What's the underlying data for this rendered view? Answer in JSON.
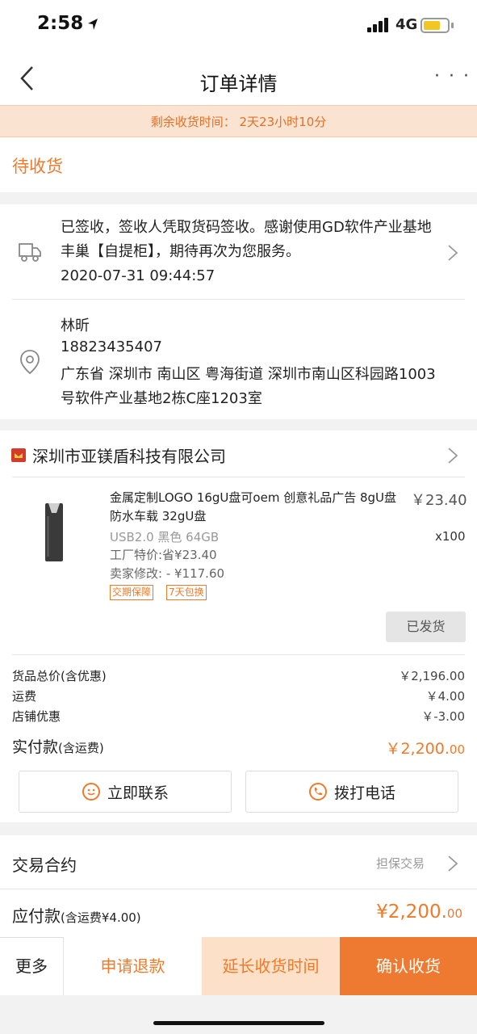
{
  "status_bar": {
    "time": "2:58",
    "network": "4G"
  },
  "nav": {
    "title": "订单详情",
    "more": "· · ·"
  },
  "countdown": "剩余收货时间：  2天23小时10分",
  "order_status": "待收货",
  "logistics": {
    "message": "已签收，签收人凭取货码签收。感谢使用GD软件产业基地丰巢【自提柜】，期待再次为您服务。",
    "time": "2020-07-31 09:44:57"
  },
  "address": {
    "name": "林昕",
    "phone": "18823435407",
    "full": "广东省 深圳市 南山区 粤海街道 深圳市南山区科园路1003号软件产业基地2栋C座1203室"
  },
  "shop": {
    "name": "深圳市亚镁盾科技有限公司"
  },
  "product": {
    "title": "金属定制LOGO 16gU盘可oem 创意礼品广告 8gU盘 防水车载 32gU盘",
    "price": "￥23.40",
    "quantity": "x100",
    "sku": "USB2.0 黑色 64GB",
    "factory_price": "工厂特价:省¥23.40",
    "seller_edit": "卖家修改: - ¥117.60",
    "tags": [
      "交期保障",
      "7天包换"
    ],
    "shipped_label": "已发货"
  },
  "fees": [
    {
      "label": "货品总价(含优惠)",
      "value": "￥2,196.00"
    },
    {
      "label": "运费",
      "value": "￥4.00"
    },
    {
      "label": "店铺优惠",
      "value": "￥-3.00"
    }
  ],
  "paid": {
    "label": "实付款",
    "label_note": "(含运费)",
    "value_main": "￥2,200.",
    "value_cents": "00"
  },
  "actions": {
    "contact": "立即联系",
    "call": "拨打电话"
  },
  "contract": {
    "label": "交易合约",
    "value": "担保交易"
  },
  "due": {
    "label": "应付款",
    "label_note": "(含运费¥4.00)",
    "value_main": "¥2,200.",
    "value_cents": "00"
  },
  "bottom_bar": {
    "more": "更多",
    "refund": "申请退款",
    "extend": "延长收货时间",
    "confirm": "确认收货"
  },
  "colors": {
    "accent": "#f07a2a",
    "confirm_bg": "#ee7a31",
    "countdown_bg": "#fbe3d2",
    "battery": "#f3c623"
  }
}
